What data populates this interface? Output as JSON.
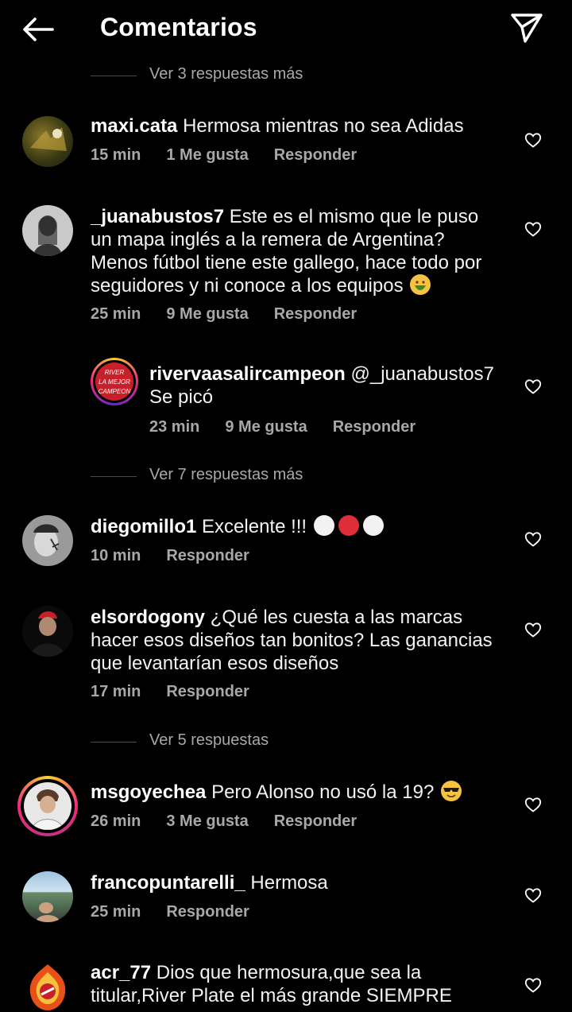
{
  "header": {
    "title": "Comentarios",
    "back_icon": "arrow-left-icon",
    "send_icon": "paper-plane-icon"
  },
  "more_replies": [
    "Ver 3 respuestas más",
    "Ver 7 respuestas más",
    "Ver 5 respuestas"
  ],
  "comments": [
    {
      "user": "maxi.cata",
      "text": "Hermosa mientras no sea Adidas",
      "time": "15 min",
      "likes": "1 Me gusta",
      "reply": "Responder"
    },
    {
      "user": "_juanabustos7",
      "text": "Este es el mismo que le puso un mapa inglés a la remera de Argentina? Menos fútbol tiene este gallego, hace todo por seguidores y ni conoce a los equipos",
      "time": "25 min",
      "likes": "9 Me gusta",
      "reply": "Responder"
    },
    {
      "user": "rivervaasalircampeon",
      "mention": "@_juanabustos7",
      "text": "Se picó",
      "time": "23 min",
      "likes": "9 Me gusta",
      "reply": "Responder"
    },
    {
      "user": "diegomillo1",
      "text": "Excelente !!!",
      "time": "10 min",
      "reply": "Responder"
    },
    {
      "user": "elsordogony",
      "text": "¿Qué les cuesta a las marcas hacer esos diseños tan bonitos? Las ganancias que levantarían esos diseños",
      "time": "17 min",
      "reply": "Responder"
    },
    {
      "user": "msgoyechea",
      "text": "Pero Alonso no usó la 19?",
      "time": "26 min",
      "likes": "3 Me gusta",
      "reply": "Responder"
    },
    {
      "user": "francopuntarelli_",
      "text": "Hermosa",
      "time": "25 min",
      "reply": "Responder"
    },
    {
      "user": "acr_77",
      "text": "Dios que hermosura,que sea la titular,River Plate el más grande SIEMPRE"
    }
  ],
  "avatar_logo_text": "RIVER LA MEJOR CAMPEON",
  "colors": {
    "background": "#000000",
    "secondary_text": "#a8a8a8",
    "story_ring": "#e1306c"
  }
}
